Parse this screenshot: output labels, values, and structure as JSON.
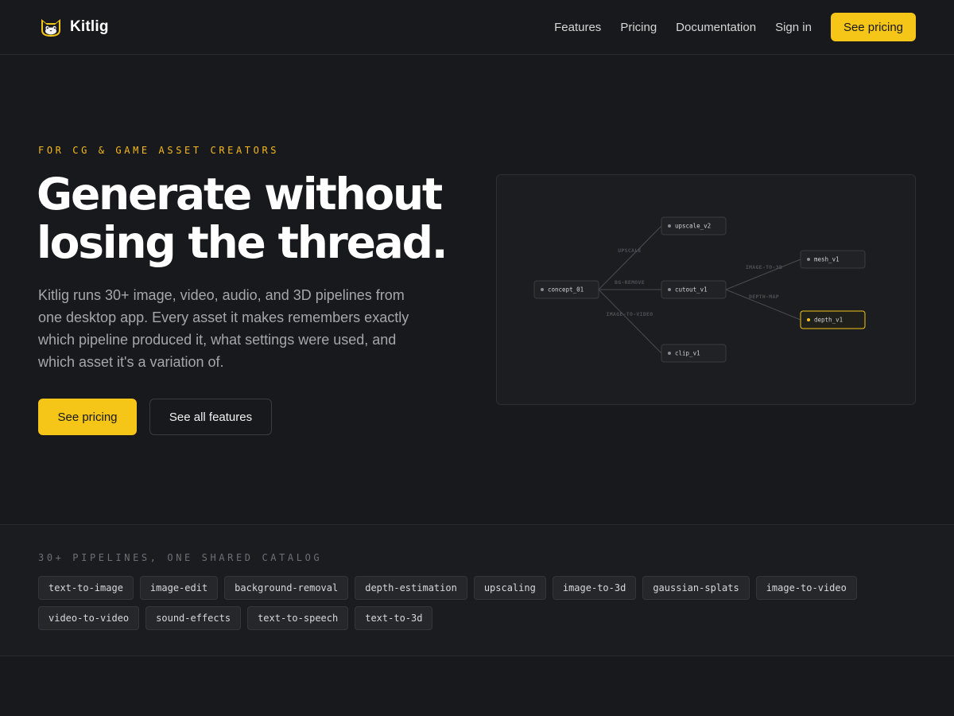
{
  "header": {
    "brand_name": "Kitlig",
    "logo_icon": "cat-face-icon",
    "nav": [
      {
        "label": "Features"
      },
      {
        "label": "Pricing"
      },
      {
        "label": "Documentation"
      },
      {
        "label": "Sign in"
      }
    ],
    "cta_label": "See pricing"
  },
  "hero": {
    "eyebrow": "FOR CG & GAME ASSET CREATORS",
    "title_line1": "Generate without",
    "title_line2": "losing the thread.",
    "description": "Kitlig runs 30+ image, video, audio, and 3D pipelines from one desktop app. Every asset it makes remembers exactly which pipeline produced it, what settings were used, and which asset it's a variation of.",
    "primary_cta": "See pricing",
    "secondary_cta": "See all features"
  },
  "graph": {
    "nodes": [
      {
        "id": "concept",
        "label": "concept_01"
      },
      {
        "id": "upscale",
        "label": "upscale_v2"
      },
      {
        "id": "cutout",
        "label": "cutout_v1"
      },
      {
        "id": "clip",
        "label": "clip_v1"
      },
      {
        "id": "mesh",
        "label": "mesh_v1"
      },
      {
        "id": "depth",
        "label": "depth_v1",
        "highlighted": true
      }
    ],
    "edges": [
      {
        "from": "concept",
        "to": "upscale",
        "label": "UPSCALE"
      },
      {
        "from": "concept",
        "to": "cutout",
        "label": "BG-REMOVE"
      },
      {
        "from": "concept",
        "to": "clip",
        "label": "IMAGE-TO-VIDEO"
      },
      {
        "from": "cutout",
        "to": "mesh",
        "label": "IMAGE-TO-3D"
      },
      {
        "from": "cutout",
        "to": "depth",
        "label": "DEPTH-MAP"
      }
    ],
    "colors": {
      "highlight": "#f5c518",
      "node_border": "#3a3b40",
      "edge": "#4a4b50"
    }
  },
  "pipelines": {
    "label": "30+ PIPELINES, ONE SHARED CATALOG",
    "chips": [
      "text-to-image",
      "image-edit",
      "background-removal",
      "depth-estimation",
      "upscaling",
      "image-to-3d",
      "gaussian-splats",
      "image-to-video",
      "video-to-video",
      "sound-effects",
      "text-to-speech",
      "text-to-3d"
    ]
  },
  "colors": {
    "accent": "#f5c518",
    "background": "#18191c"
  }
}
